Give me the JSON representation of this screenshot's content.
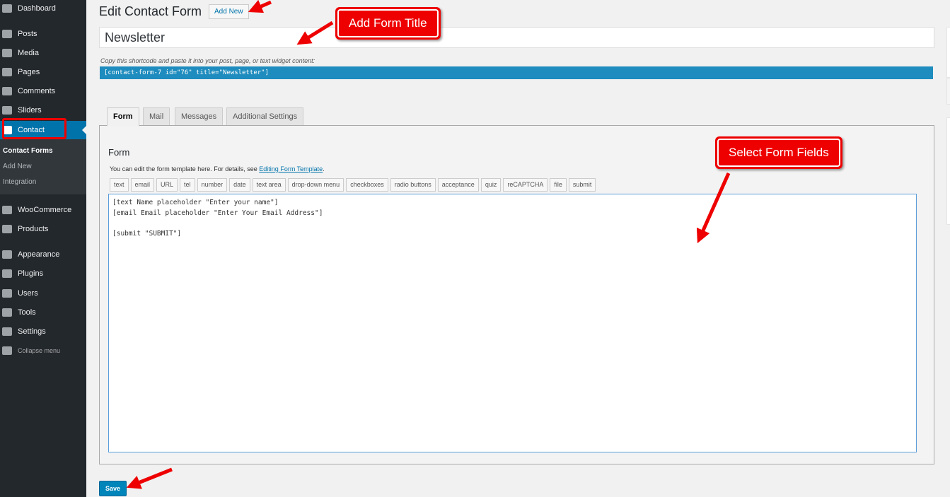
{
  "sidebar": {
    "items": [
      {
        "label": "Dashboard",
        "icon": "dashboard-icon"
      },
      {
        "label": "Posts",
        "icon": "pin-icon"
      },
      {
        "label": "Media",
        "icon": "media-icon"
      },
      {
        "label": "Pages",
        "icon": "pages-icon"
      },
      {
        "label": "Comments",
        "icon": "comment-icon"
      },
      {
        "label": "Sliders",
        "icon": "sliders-icon"
      },
      {
        "label": "Contact",
        "icon": "mail-check-icon"
      },
      {
        "label": "WooCommerce",
        "icon": "woo-icon"
      },
      {
        "label": "Products",
        "icon": "box-icon"
      },
      {
        "label": "Appearance",
        "icon": "brush-icon"
      },
      {
        "label": "Plugins",
        "icon": "plug-icon"
      },
      {
        "label": "Users",
        "icon": "user-icon"
      },
      {
        "label": "Tools",
        "icon": "wrench-icon"
      },
      {
        "label": "Settings",
        "icon": "settings-icon"
      },
      {
        "label": "Collapse menu",
        "icon": "collapse-icon"
      }
    ],
    "submenu": [
      "Contact Forms",
      "Add New",
      "Integration"
    ]
  },
  "header": {
    "title": "Edit Contact Form",
    "add_new": "Add New"
  },
  "form_title": "Newsletter",
  "shortcode_hint": "Copy this shortcode and paste it into your post, page, or text widget content:",
  "shortcode": "[contact-form-7 id=\"76\" title=\"Newsletter\"]",
  "tabs": [
    "Form",
    "Mail",
    "Messages",
    "Additional Settings"
  ],
  "panel": {
    "title": "Form",
    "desc": "You can edit the form template here. For details, see ",
    "link": "Editing Form Template",
    "tags": [
      "text",
      "email",
      "URL",
      "tel",
      "number",
      "date",
      "text area",
      "drop-down menu",
      "checkboxes",
      "radio buttons",
      "acceptance",
      "quiz",
      "reCAPTCHA",
      "file",
      "submit"
    ],
    "template": "[text Name placeholder \"Enter your name\"]\n[email Email placeholder \"Enter Your Email Address\"]\n\n[submit \"SUBMIT\"]"
  },
  "save": "Save",
  "annotations": {
    "title_callout": "Add Form Title",
    "fields_callout": "Select Form Fields",
    "color": "#ee0000"
  }
}
